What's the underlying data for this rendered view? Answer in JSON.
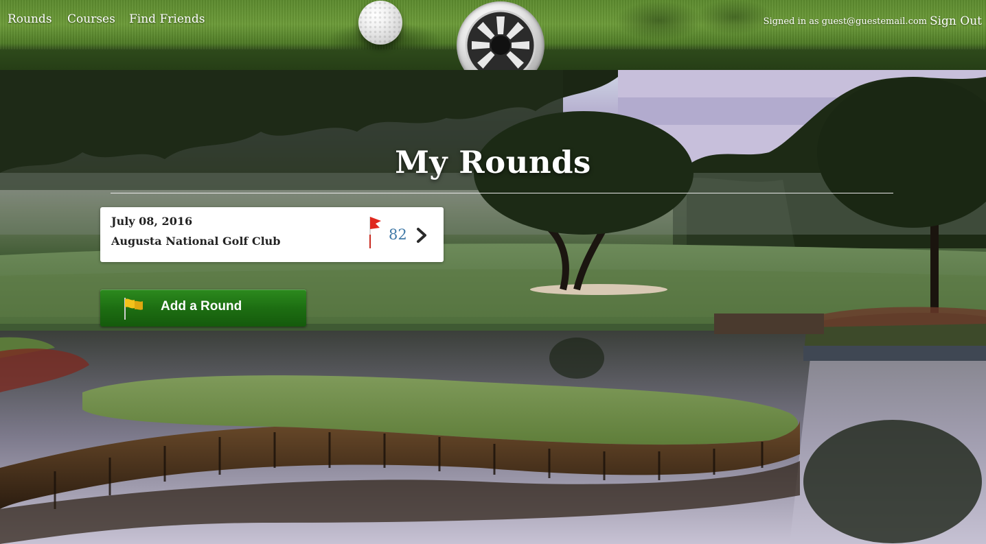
{
  "nav": {
    "rounds": "Rounds",
    "courses": "Courses",
    "find_friends": "Find Friends"
  },
  "account": {
    "signed_in_text": "Signed in as guest@guestemail.com",
    "sign_out": "Sign Out"
  },
  "page": {
    "title": "My Rounds"
  },
  "rounds": [
    {
      "date": "July 08, 2016",
      "course": "Augusta National Golf Club",
      "score": "82",
      "flag_icon": "red-pin-flag-icon",
      "arrow_icon": "chevron-right-icon"
    }
  ],
  "actions": {
    "add_round": "Add a Round",
    "add_round_icon": "yellow-flag-icon"
  },
  "colors": {
    "score": "#3f78a6",
    "button_green": "#1d6e12",
    "flag_red": "#e0281e"
  }
}
